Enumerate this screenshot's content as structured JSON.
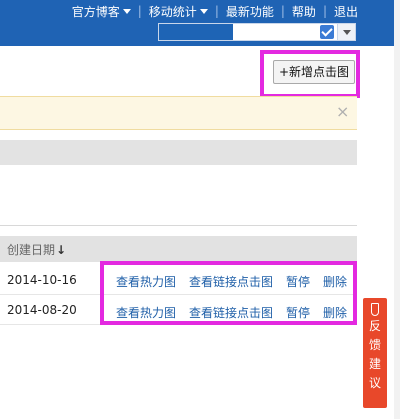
{
  "topnav": {
    "items": [
      {
        "label": "官方博客",
        "dropdown": true
      },
      {
        "label": "移动统计",
        "dropdown": true
      },
      {
        "label": "最新功能",
        "dropdown": false
      },
      {
        "label": "帮助",
        "dropdown": false
      },
      {
        "label": "退出",
        "dropdown": false
      }
    ]
  },
  "toolbar": {
    "add_button_label": "+新增点击图"
  },
  "notice": {
    "close_symbol": "×"
  },
  "table": {
    "column_date_label": "创建日期",
    "sort_symbol": "↓",
    "rows": [
      {
        "date": "2014-10-16",
        "actions": [
          "查看热力图",
          "查看链接点击图",
          "暂停",
          "删除"
        ]
      },
      {
        "date": "2014-08-20",
        "actions": [
          "查看热力图",
          "查看链接点击图",
          "暂停",
          "删除"
        ]
      }
    ]
  },
  "feedback": {
    "chars": [
      "反",
      "馈",
      "建",
      "议"
    ]
  },
  "colors": {
    "header_blue": "#1f63b4",
    "highlight_magenta": "#e329e0",
    "link_blue": "#1f5fa8",
    "feedback_red": "#e8482a"
  }
}
